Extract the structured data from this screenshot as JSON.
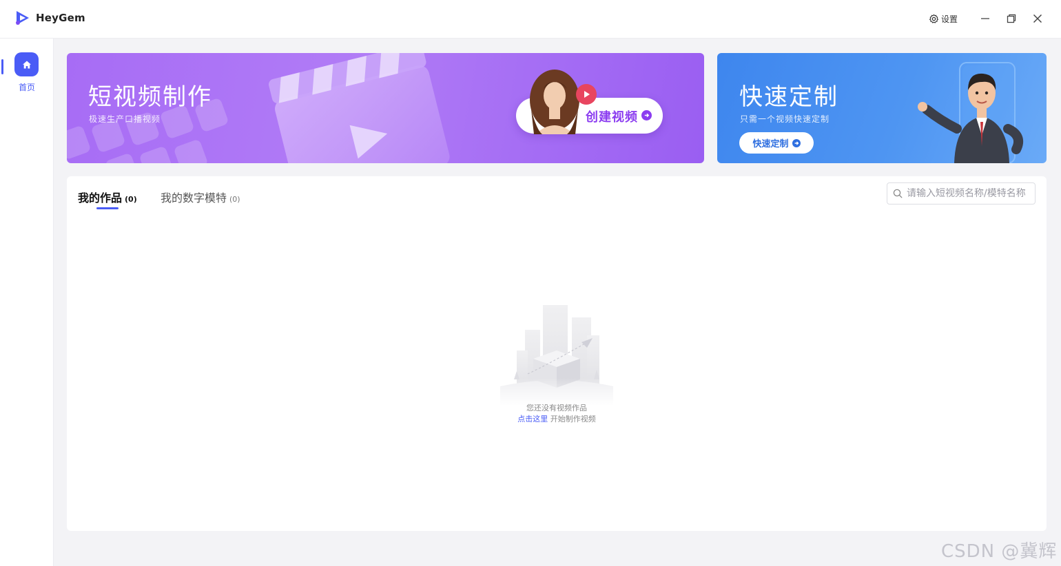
{
  "app": {
    "name": "HeyGem"
  },
  "titlebar": {
    "settings_label": "设置"
  },
  "sidebar": {
    "items": [
      {
        "label": "首页",
        "icon": "home-icon"
      }
    ]
  },
  "banners": {
    "short_video": {
      "title": "短视频制作",
      "subtitle": "极速生产口播视频",
      "button_label": "创建视频"
    },
    "quick_custom": {
      "title": "快速定制",
      "subtitle": "只需一个视频快速定制",
      "button_label": "快速定制"
    }
  },
  "tabs": [
    {
      "label": "我的作品",
      "count": "(0)",
      "active": true
    },
    {
      "label": "我的数字模特",
      "count": "(0)",
      "active": false
    }
  ],
  "search": {
    "placeholder": "请输入短视频名称/模特名称"
  },
  "empty_state": {
    "message": "您还没有视频作品",
    "link_text": "点击这里",
    "link_suffix": " 开始制作视频"
  },
  "watermark": "CSDN @冀辉",
  "colors": {
    "accent": "#4a5cf6",
    "banner_purple": "#a76cf5",
    "banner_blue": "#3e86ee",
    "create_button_text": "#8b3cf0"
  }
}
